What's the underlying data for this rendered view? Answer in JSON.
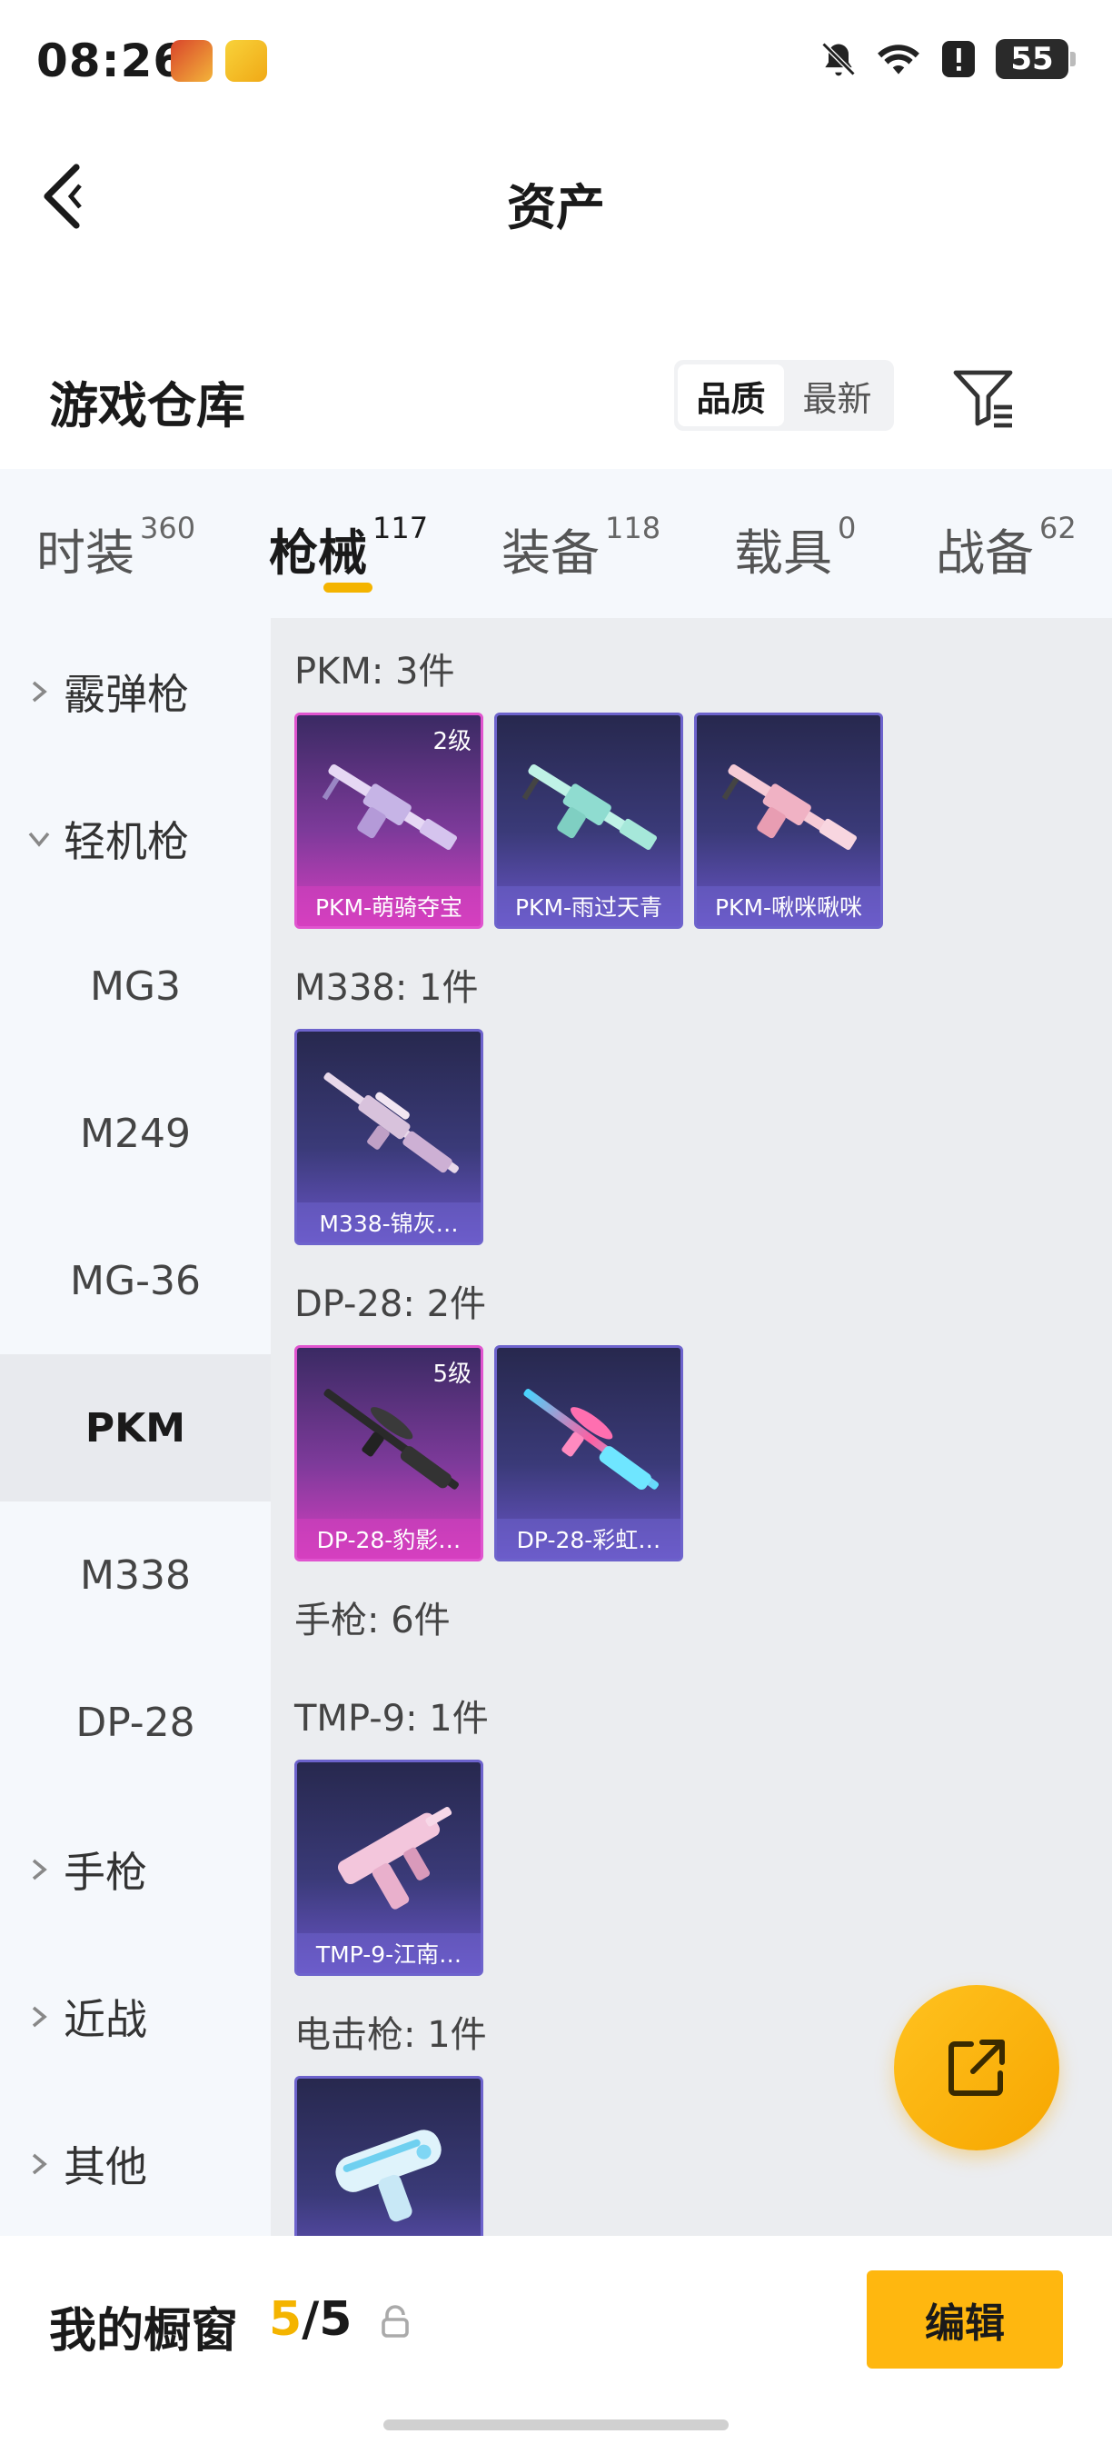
{
  "status_bar": {
    "time": "08:26",
    "battery": "55"
  },
  "header": {
    "title": "资产"
  },
  "section": {
    "title": "游戏仓库"
  },
  "sort": {
    "options": [
      "品质",
      "最新"
    ],
    "active": "品质"
  },
  "tabs": [
    {
      "label": "时装",
      "count": "360"
    },
    {
      "label": "枪械",
      "count": "117",
      "active": true
    },
    {
      "label": "装备",
      "count": "118"
    },
    {
      "label": "载具",
      "count": "0"
    },
    {
      "label": "战备",
      "count": "62"
    }
  ],
  "sidebar": {
    "items": [
      {
        "label": "霰弹枪",
        "type": "group",
        "expanded": false
      },
      {
        "label": "轻机枪",
        "type": "group",
        "expanded": true
      },
      {
        "label": "MG3",
        "type": "sub"
      },
      {
        "label": "M249",
        "type": "sub"
      },
      {
        "label": "MG-36",
        "type": "sub"
      },
      {
        "label": "PKM",
        "type": "sub",
        "active": true
      },
      {
        "label": "M338",
        "type": "sub"
      },
      {
        "label": "DP-28",
        "type": "sub"
      },
      {
        "label": "手枪",
        "type": "group",
        "expanded": false
      },
      {
        "label": "近战",
        "type": "group",
        "expanded": false
      },
      {
        "label": "其他",
        "type": "group",
        "expanded": false
      }
    ]
  },
  "groups": [
    {
      "title": "PKM: 3件",
      "cards": [
        {
          "name": "PKM-萌骑夺宝",
          "level": "2级",
          "rarity": "pink"
        },
        {
          "name": "PKM-雨过天青",
          "rarity": "purple"
        },
        {
          "name": "PKM-啾咪啾咪",
          "rarity": "purple"
        }
      ]
    },
    {
      "title": "M338: 1件",
      "cards": [
        {
          "name": "M338-锦灰…",
          "rarity": "purple"
        }
      ]
    },
    {
      "title": "DP-28: 2件",
      "cards": [
        {
          "name": "DP-28-豹影…",
          "level": "5级",
          "rarity": "pink"
        },
        {
          "name": "DP-28-彩虹…",
          "rarity": "purple"
        }
      ]
    },
    {
      "title": "手枪: 6件",
      "cards": []
    },
    {
      "title": "TMP-9: 1件",
      "cards": [
        {
          "name": "TMP-9-江南…",
          "rarity": "purple"
        }
      ]
    },
    {
      "title": "电击枪: 1件",
      "cards": [
        {
          "name": "",
          "rarity": "purple"
        }
      ]
    }
  ],
  "bottom_bar": {
    "label": "我的橱窗",
    "count_used": "5",
    "count_sep": "/",
    "count_total": "5",
    "edit_label": "编辑"
  },
  "colors": {
    "accent": "#f4b400",
    "pink_card": "#d63fc0",
    "purple_card": "#6d63cc"
  }
}
